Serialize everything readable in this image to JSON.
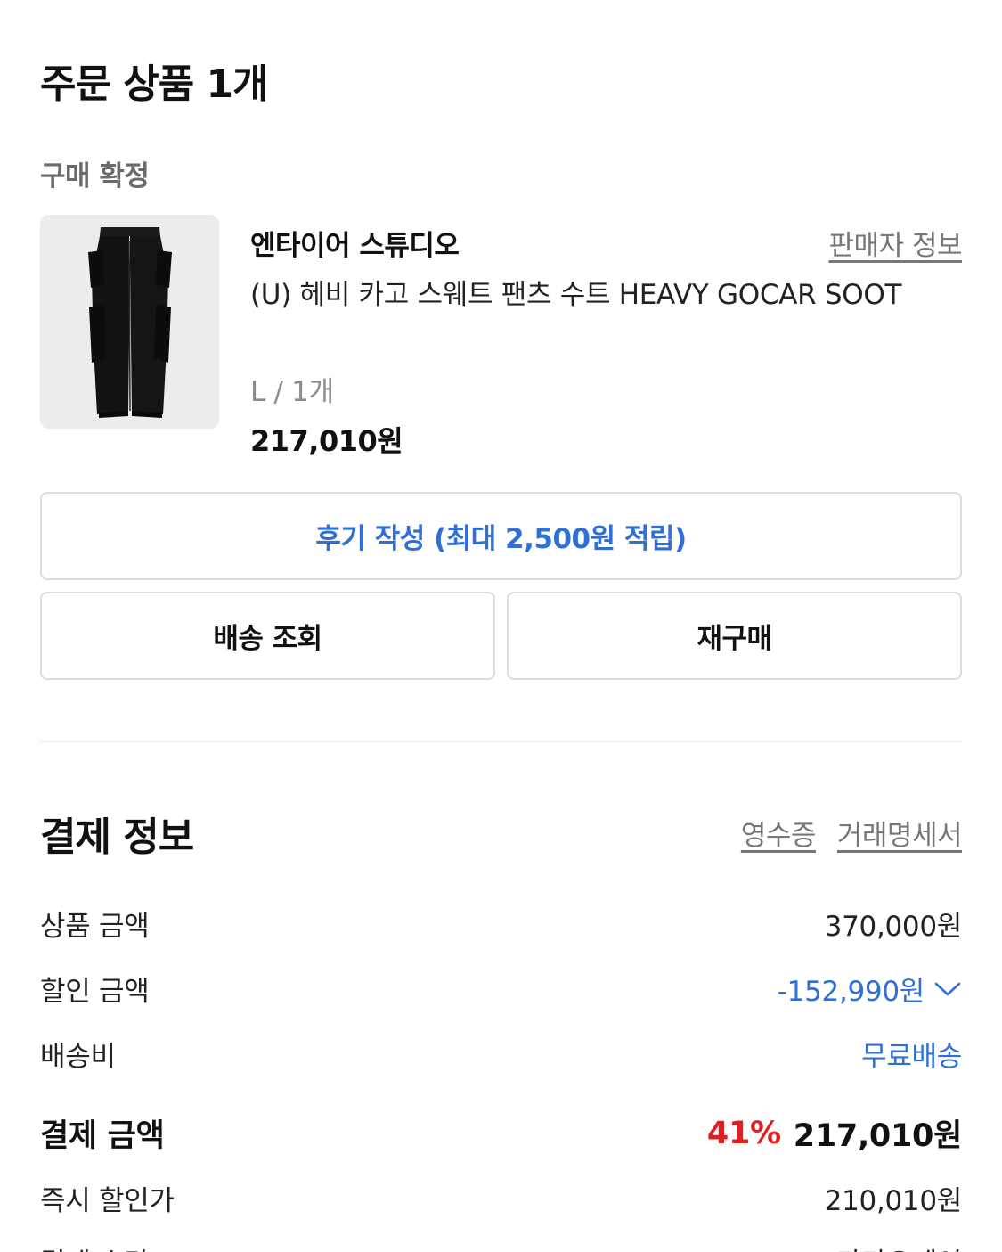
{
  "order": {
    "title": "주문 상품 1개",
    "status": "구매 확정"
  },
  "product": {
    "image_icon": "cargo-pants-image",
    "brand": "엔타이어 스튜디오",
    "seller_link": "판매자 정보",
    "name": "(U) 헤비 카고 스웨트 팬츠 수트 HEAVY GOCAR SOOT",
    "option": "L / 1개",
    "price": "217,010원"
  },
  "actions": {
    "review": "후기 작성 (최대 2,500원 적립)",
    "track": "배송 조회",
    "rebuy": "재구매"
  },
  "payment": {
    "title": "결제 정보",
    "receipt_link": "영수증",
    "statement_link": "거래명세서",
    "rows": {
      "product_amount": {
        "label": "상품 금액",
        "value": "370,000원"
      },
      "discount_amount": {
        "label": "할인 금액",
        "value": "-152,990원"
      },
      "shipping": {
        "label": "배송비",
        "value": "무료배송"
      },
      "total": {
        "label": "결제 금액",
        "rate": "41%",
        "value": "217,010원"
      },
      "instant_discount": {
        "label": "즉시 할인가",
        "value": "210,010원"
      },
      "partial_row": {
        "label": "결제 수단",
        "value": "카카오페이"
      }
    }
  },
  "colors": {
    "accent_blue": "#2f6fd6",
    "discount_red": "#e02020",
    "muted_gray": "#777777",
    "border": "#dcdcdc"
  }
}
